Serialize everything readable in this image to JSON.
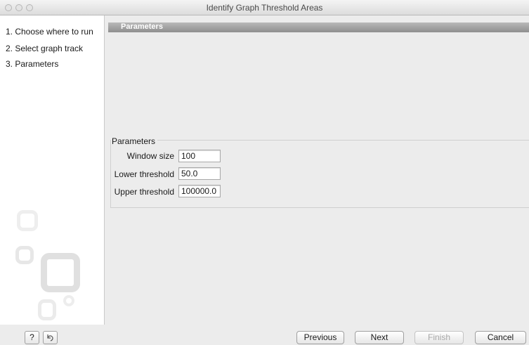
{
  "window": {
    "title": "Identify Graph Threshold Areas"
  },
  "sidebar": {
    "steps": [
      {
        "label": "1. Choose where to run"
      },
      {
        "label": "2. Select graph track"
      },
      {
        "label": "3. Parameters"
      }
    ]
  },
  "main": {
    "header_title": "Parameters",
    "group": {
      "legend": "Parameters",
      "fields": [
        {
          "label": "Window size",
          "value": "100"
        },
        {
          "label": "Lower threshold",
          "value": "50.0"
        },
        {
          "label": "Upper threshold",
          "value": "100000.0"
        }
      ]
    }
  },
  "footer": {
    "help_symbol": "?",
    "previous": "Previous",
    "next": "Next",
    "finish": "Finish",
    "cancel": "Cancel"
  },
  "icons": {
    "window_controls": [
      "close-icon",
      "minimize-icon",
      "zoom-icon"
    ],
    "restore_defaults": "restore-defaults-icon"
  }
}
